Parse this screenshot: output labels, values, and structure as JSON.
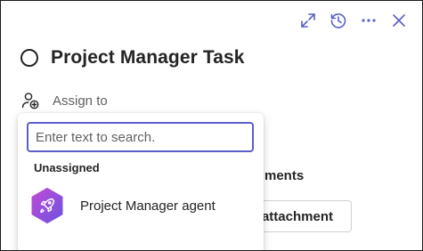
{
  "header": {
    "icons": [
      "expand-icon",
      "history-icon",
      "more-icon",
      "close-icon"
    ]
  },
  "task": {
    "title": "Project Manager Task"
  },
  "assign": {
    "label": "Assign to"
  },
  "background": {
    "attachments_label": "ments",
    "attach_button_label": "attachment"
  },
  "dropdown": {
    "search_placeholder": "Enter text to search.",
    "section_label": "Unassigned",
    "options": [
      {
        "label": "Project Manager agent",
        "icon": "rocket-icon"
      }
    ]
  },
  "colors": {
    "accent": "#5b5fc7",
    "agent_gradient_start": "#c04bd6",
    "agent_gradient_end": "#6c54e0",
    "text": "#242424",
    "muted_text": "#616161"
  }
}
